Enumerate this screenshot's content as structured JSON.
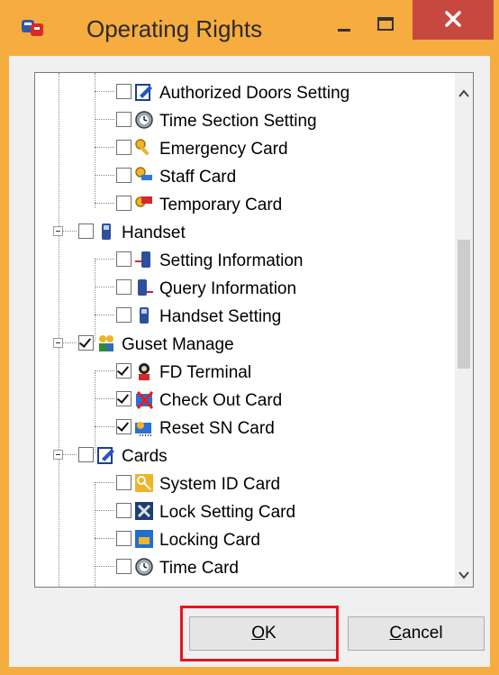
{
  "window": {
    "title": "Operating Rights",
    "colors": {
      "frame": "#f6ac3f",
      "close": "#c7483f",
      "highlight": "#e8141c"
    }
  },
  "tree": {
    "rows": [
      {
        "label": "Authorized Doors Setting",
        "level": 2,
        "checked": false,
        "icon": "authorize-doors-icon"
      },
      {
        "label": "Time Section Setting",
        "level": 2,
        "checked": false,
        "icon": "time-section-icon"
      },
      {
        "label": "Emergency Card",
        "level": 2,
        "checked": false,
        "icon": "emergency-key-icon"
      },
      {
        "label": "Staff Card",
        "level": 2,
        "checked": false,
        "icon": "staff-key-icon"
      },
      {
        "label": "Temporary Card",
        "level": 2,
        "checked": false,
        "icon": "temporary-key-icon"
      },
      {
        "label": "Handset",
        "level": 1,
        "checked": false,
        "icon": "handset-icon"
      },
      {
        "label": "Setting Information",
        "level": 2,
        "checked": false,
        "icon": "setting-info-icon"
      },
      {
        "label": "Query Information",
        "level": 2,
        "checked": false,
        "icon": "query-info-icon"
      },
      {
        "label": "Handset Setting",
        "level": 2,
        "checked": false,
        "icon": "handset-setting-icon"
      },
      {
        "label": "Guset Manage",
        "level": 1,
        "checked": true,
        "icon": "guests-icon"
      },
      {
        "label": "FD Terminal",
        "level": 2,
        "checked": true,
        "icon": "terminal-user-icon"
      },
      {
        "label": "Check Out Card",
        "level": 2,
        "checked": true,
        "icon": "check-out-card-icon"
      },
      {
        "label": "Reset SN Card",
        "level": 2,
        "checked": true,
        "icon": "reset-sn-card-icon"
      },
      {
        "label": "Cards",
        "level": 1,
        "checked": false,
        "icon": "cards-icon"
      },
      {
        "label": "System ID Card",
        "level": 2,
        "checked": false,
        "icon": "system-id-key-icon"
      },
      {
        "label": "Lock Setting Card",
        "level": 2,
        "checked": false,
        "icon": "lock-setting-icon"
      },
      {
        "label": "Locking Card",
        "level": 2,
        "checked": false,
        "icon": "locking-card-icon"
      },
      {
        "label": "Time Card",
        "level": 2,
        "checked": false,
        "icon": "time-card-icon"
      }
    ]
  },
  "buttons": {
    "ok_label": "OK",
    "ok_mnemonic": "O",
    "ok_rest": "K",
    "cancel_label": "Cancel",
    "cancel_mnemonic": "C",
    "cancel_rest": "ancel"
  }
}
